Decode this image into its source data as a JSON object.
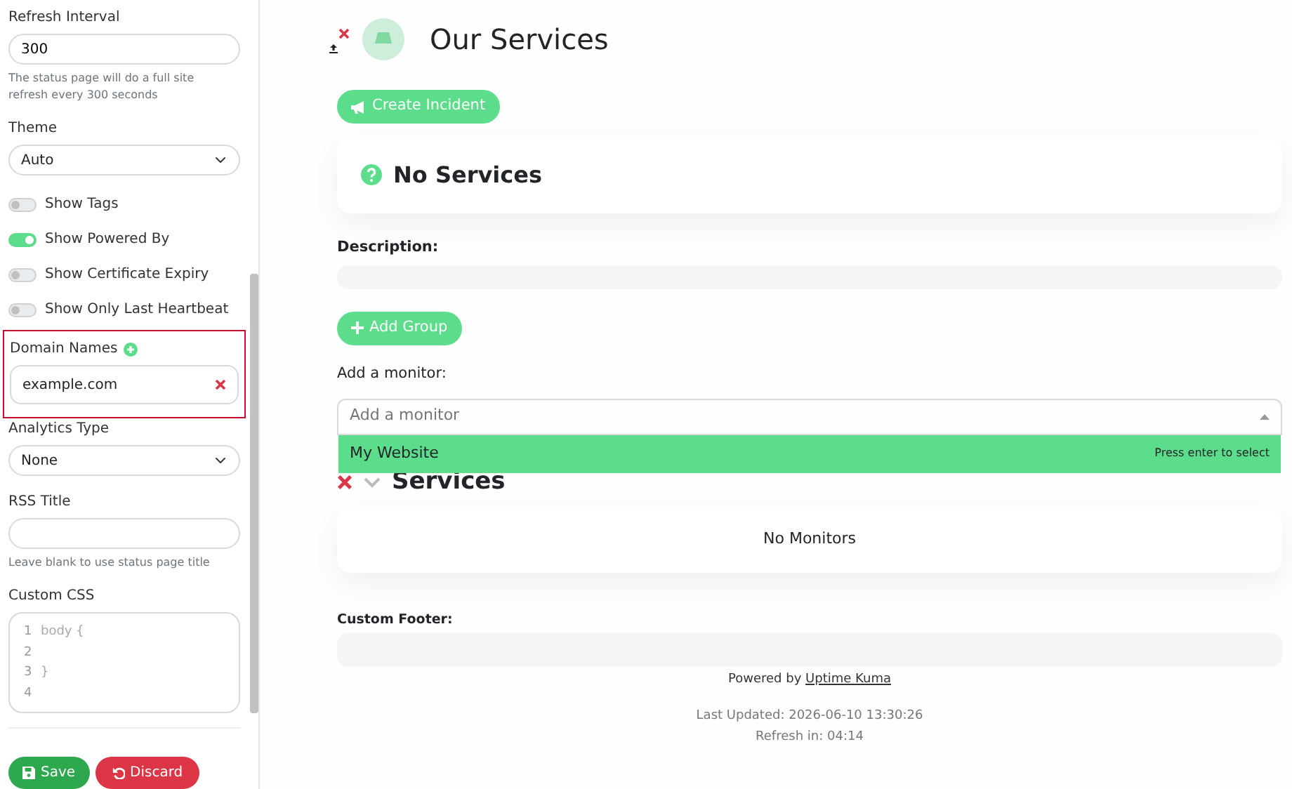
{
  "sidebar": {
    "refresh_interval": {
      "label": "Refresh Interval",
      "value": "300",
      "help": "The status page will do a full site refresh every 300 seconds"
    },
    "theme": {
      "label": "Theme",
      "value": "Auto"
    },
    "toggles": [
      {
        "label": "Show Tags",
        "on": false
      },
      {
        "label": "Show Powered By",
        "on": true
      },
      {
        "label": "Show Certificate Expiry",
        "on": false
      },
      {
        "label": "Show Only Last Heartbeat",
        "on": false
      }
    ],
    "domain_names": {
      "label": "Domain Names",
      "highlighted": true,
      "items": [
        "example.com"
      ]
    },
    "analytics_type": {
      "label": "Analytics Type",
      "value": "None"
    },
    "rss_title": {
      "label": "RSS Title",
      "help": "Leave blank to use status page title"
    },
    "custom_css": {
      "label": "Custom CSS",
      "lines": [
        {
          "number": "1",
          "code": "body {"
        },
        {
          "number": "2"
        },
        {
          "number": "3",
          "code": "}"
        },
        {
          "number": "4"
        }
      ]
    },
    "buttons": [
      {
        "label": "Save",
        "kind": "save"
      },
      {
        "label": "Discard",
        "kind": "discard"
      }
    ]
  },
  "header": {
    "title": "Our Services"
  },
  "create_incident": "Create Incident",
  "no_services": "No Services",
  "description_label": "Description:",
  "add_group": "Add Group",
  "add_monitor": {
    "label": "Add a monitor:",
    "placeholder": "Add a monitor",
    "options": [
      {
        "label": "My Website",
        "hint": "Press enter to select",
        "selected": true
      }
    ]
  },
  "group": {
    "title": "Services",
    "empty": "No Monitors"
  },
  "footer": {
    "label": "Custom Footer:",
    "powered_by": "Powered by",
    "powered_by_link": "Uptime Kuma",
    "last_updated": "Last Updated: 2026-06-10 13:30:26",
    "refresh": "Refresh in: 04:14"
  }
}
